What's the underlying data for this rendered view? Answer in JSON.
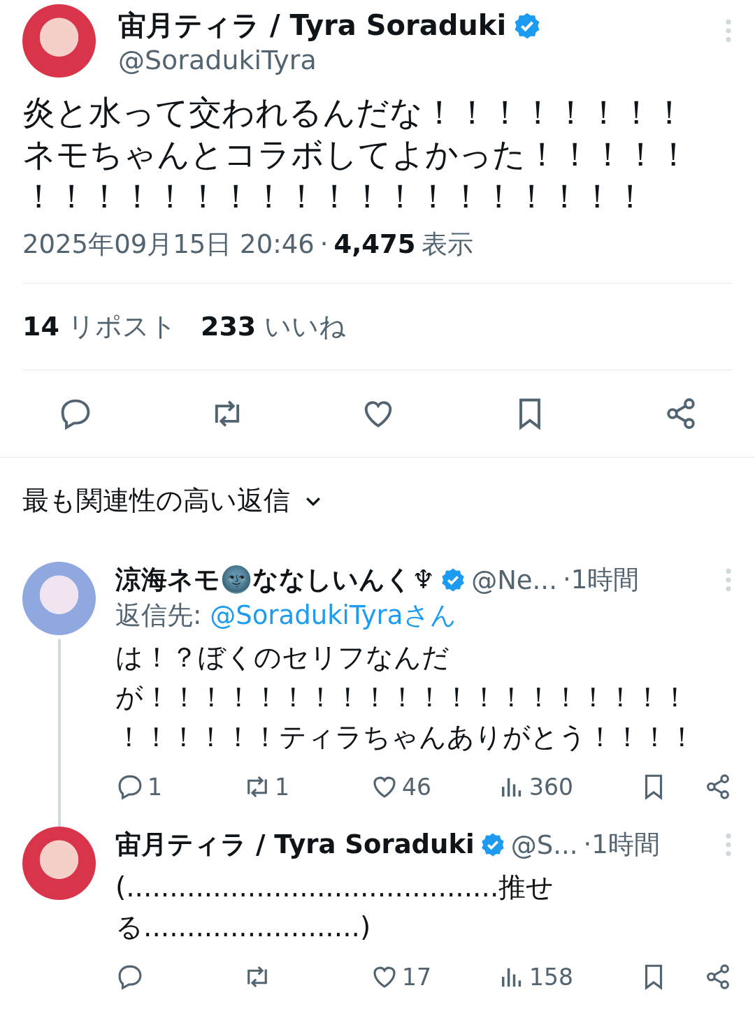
{
  "post": {
    "author_name": "宙月ティラ / Tyra Soraduki",
    "verified": true,
    "handle": "@SoradukiTyra",
    "text_lines": [
      "炎と水って交われるんだな！！！！！！！！",
      "ネモちゃんとコラボしてよかった！！！！！",
      "！！！！！！！！！！！！！！！！！！！"
    ],
    "timestamp": "2025年09月15日 20:46",
    "separator": "·",
    "views_count": "4,475",
    "views_label": "表示",
    "stats": [
      {
        "count": "14",
        "label": "リポスト"
      },
      {
        "count": "233",
        "label": "いいね"
      }
    ]
  },
  "replies_sort": {
    "label": "最も関連性の高い返信"
  },
  "replies": [
    {
      "author_name": "涼海ネモ🌚ななしいんく♆",
      "verified": true,
      "handle": "@Ne...",
      "time": "·1時間",
      "reply_to_prefix": "返信先: ",
      "reply_to": "@SoradukiTyraさん",
      "thread_line": true,
      "text_lines": [
        "は！？ぼくのセリフなんだ",
        "が！！！！！！！！！！！！！！！！！！！！",
        "！！！！！！ティラちゃんありがとう！！！！"
      ],
      "reply_count": "1",
      "repost_count": "1",
      "like_count": "46",
      "views": "360"
    },
    {
      "author_name": "宙月ティラ / Tyra Soraduki",
      "verified": true,
      "handle": "@S...",
      "time": "·1時間",
      "thread_line": false,
      "text_lines": [
        "(...........................................推せ",
        "る.........................)"
      ],
      "like_count": "17",
      "views": "158"
    }
  ]
}
